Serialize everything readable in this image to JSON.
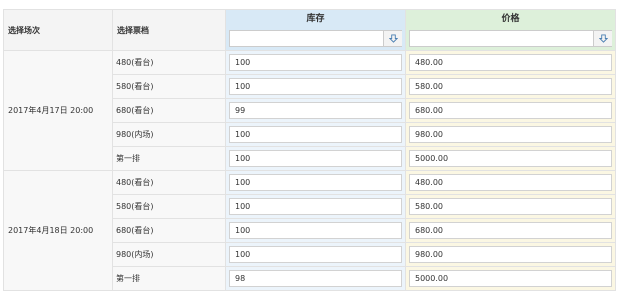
{
  "header": {
    "session_label": "选择场次",
    "ticket_label": "选择票档",
    "stock_label": "库存",
    "price_label": "价格",
    "stock_filter_value": "",
    "price_filter_value": ""
  },
  "sessions": [
    {
      "date": "2017年4月17日 20:00",
      "rows": [
        {
          "ticket": "480(看台)",
          "stock": "100",
          "price": "480.00"
        },
        {
          "ticket": "580(看台)",
          "stock": "100",
          "price": "580.00"
        },
        {
          "ticket": "680(看台)",
          "stock": "99",
          "price": "680.00"
        },
        {
          "ticket": "980(内场)",
          "stock": "100",
          "price": "980.00"
        },
        {
          "ticket": "第一排",
          "stock": "100",
          "price": "5000.00"
        }
      ]
    },
    {
      "date": "2017年4月18日 20:00",
      "rows": [
        {
          "ticket": "480(看台)",
          "stock": "100",
          "price": "480.00"
        },
        {
          "ticket": "580(看台)",
          "stock": "100",
          "price": "580.00"
        },
        {
          "ticket": "680(看台)",
          "stock": "100",
          "price": "680.00"
        },
        {
          "ticket": "980(内场)",
          "stock": "100",
          "price": "980.00"
        },
        {
          "ticket": "第一排",
          "stock": "98",
          "price": "5000.00"
        }
      ]
    }
  ],
  "icons": {
    "apply": "fill-down-icon"
  }
}
